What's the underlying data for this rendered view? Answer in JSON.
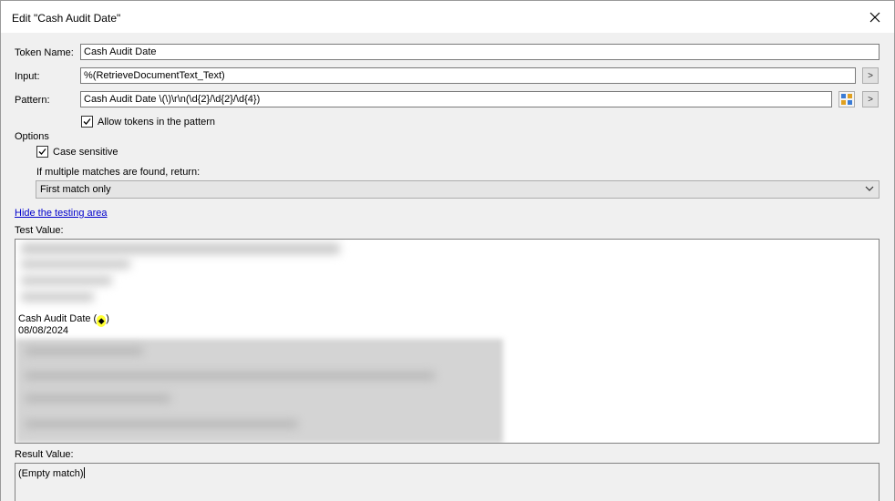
{
  "window": {
    "title": "Edit \"Cash Audit Date\""
  },
  "form": {
    "token_name_label": "Token Name:",
    "token_name_value": "Cash Audit Date",
    "input_label": "Input:",
    "input_value": "%(RetrieveDocumentText_Text)",
    "pattern_label": "Pattern:",
    "pattern_value": "Cash Audit Date \\(\\)\\r\\n(\\d{2}/\\d{2}/\\d{4})",
    "browse_button_label": ">",
    "allow_tokens_label": "Allow tokens in the pattern",
    "allow_tokens_checked": true
  },
  "options": {
    "heading": "Options",
    "case_sensitive_label": "Case sensitive",
    "case_sensitive_checked": true,
    "multiple_matches_label": "If multiple matches are found, return:",
    "multiple_matches_selected": "First match only"
  },
  "testing": {
    "hide_link": "Hide the testing area",
    "test_value_label": "Test Value:",
    "test_line1": "Cash Audit Date (",
    "test_line1_close": ")",
    "test_line2": "08/08/2024",
    "result_label": "Result Value:",
    "result_value": "(Empty match)"
  },
  "colors": {
    "highlight": "#ffff33",
    "link": "#0000cc"
  }
}
